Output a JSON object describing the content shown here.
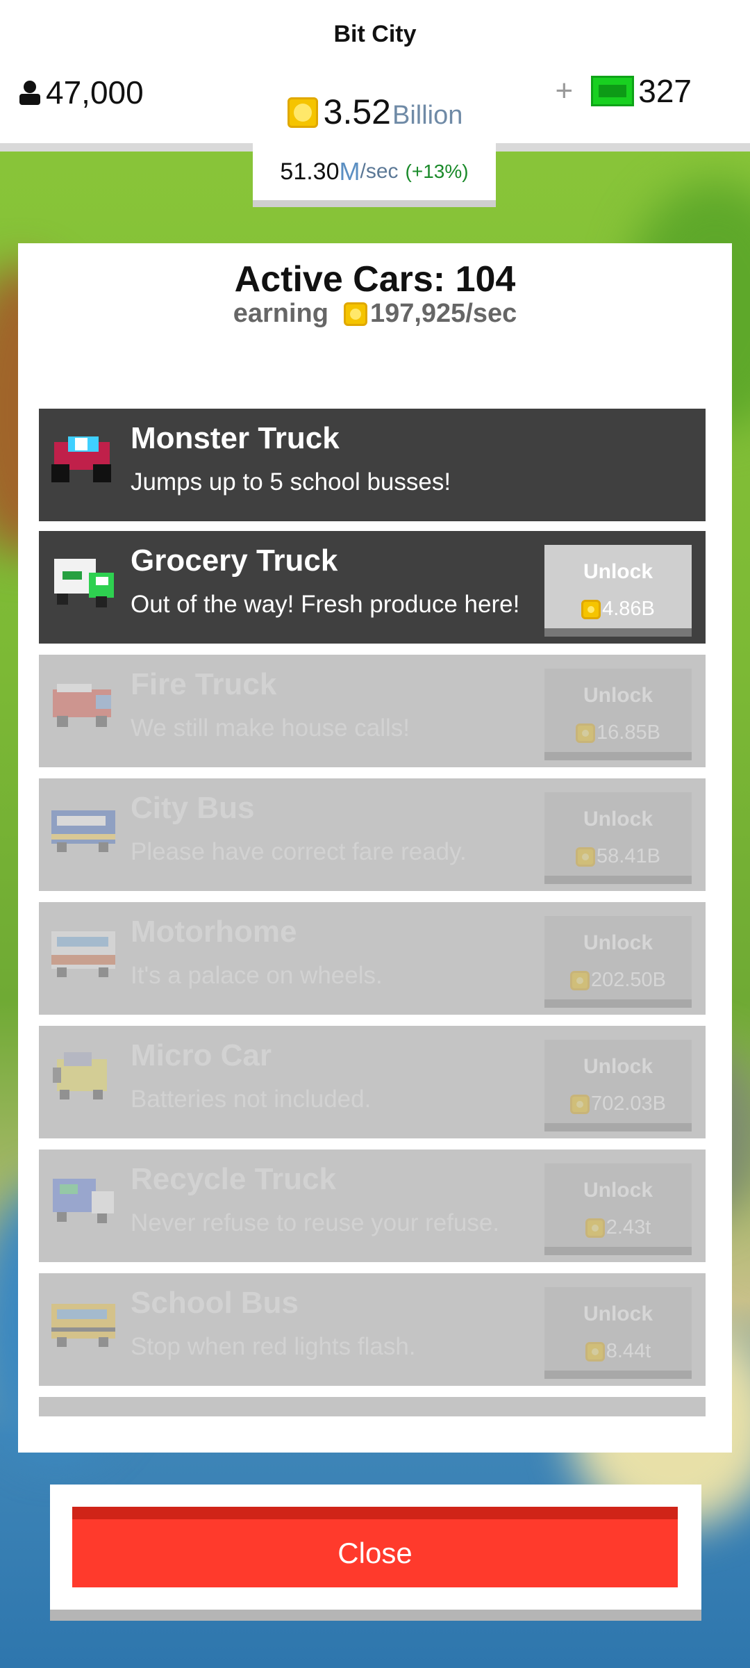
{
  "header": {
    "city_name": "Bit City",
    "population": "47,000",
    "coins_amount": "3.52",
    "coins_unit": "Billion",
    "bux_plus": "+",
    "bux_amount": "327",
    "rate_number": "51.30",
    "rate_unit": "M",
    "rate_per": "/sec",
    "rate_bonus": "(+13%)"
  },
  "panel": {
    "title": "Active Cars: 104",
    "earning_label": "earning",
    "earning_value": "197,925/sec"
  },
  "vehicles": [
    {
      "name": "Monster Truck",
      "description": "Jumps up to 5 school busses!",
      "state": "owned",
      "icon": "monster-truck-icon"
    },
    {
      "name": "Grocery Truck",
      "description": "Out of the way! Fresh produce here!",
      "state": "available",
      "unlock_label": "Unlock",
      "price": "4.86B",
      "icon": "grocery-truck-icon"
    },
    {
      "name": "Fire Truck",
      "description": "We still make house calls!",
      "state": "locked",
      "unlock_label": "Unlock",
      "price": "16.85B",
      "icon": "fire-truck-icon"
    },
    {
      "name": "City Bus",
      "description": "Please have correct fare ready.",
      "state": "locked",
      "unlock_label": "Unlock",
      "price": "58.41B",
      "icon": "city-bus-icon"
    },
    {
      "name": "Motorhome",
      "description": "It's a palace on wheels.",
      "state": "locked",
      "unlock_label": "Unlock",
      "price": "202.50B",
      "icon": "motorhome-icon"
    },
    {
      "name": "Micro Car",
      "description": "Batteries not included.",
      "state": "locked",
      "unlock_label": "Unlock",
      "price": "702.03B",
      "icon": "micro-car-icon"
    },
    {
      "name": "Recycle Truck",
      "description": "Never refuse to reuse your refuse.",
      "state": "locked",
      "unlock_label": "Unlock",
      "price": "2.43t",
      "icon": "recycle-truck-icon"
    },
    {
      "name": "School Bus",
      "description": "Stop when red lights flash.",
      "state": "locked",
      "unlock_label": "Unlock",
      "price": "8.44t",
      "icon": "school-bus-icon"
    }
  ],
  "close_button": {
    "label": "Close"
  },
  "colors": {
    "close_red": "#ff3a2c",
    "coin_gold": "#f5c400",
    "cash_green": "#18d020",
    "owned_row": "#404040",
    "locked_row": "#c4c4c4"
  }
}
